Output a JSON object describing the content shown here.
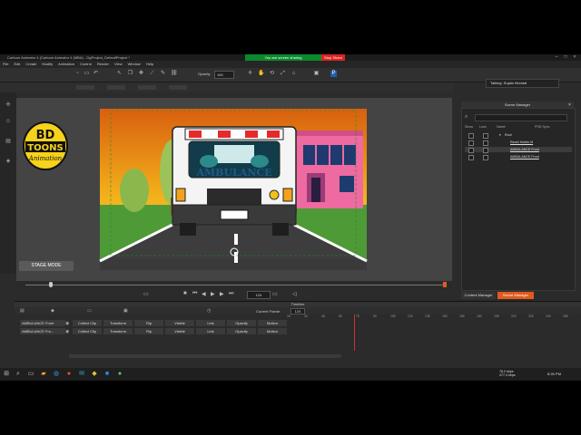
{
  "window": {
    "title": "Cartoon Animator 4 (Cartoon Animator 4 (MBA) - DgProject_DefaultProject *",
    "share_notice": "You are screen sharing",
    "stop_share": "Stop Share"
  },
  "menu": [
    "File",
    "Edit",
    "Create",
    "Modify",
    "Animation",
    "Control",
    "Render",
    "View",
    "Window",
    "Help"
  ],
  "toolbar": {
    "opacity_label": "Opacity",
    "opacity_value": "100"
  },
  "talking": "Talking: Sujato Mondal",
  "stage": {
    "mode_label": "STAGE MODE"
  },
  "playback": {
    "frame": "124"
  },
  "scene_manager": {
    "title": "Scene Manager",
    "columns": {
      "show": "Show",
      "lock": "Lock",
      "name": "Name",
      "psd": "PSD Sync"
    },
    "items": [
      {
        "name": "Root",
        "expanded": true
      },
      {
        "name": "Ricshi Holeto M"
      },
      {
        "name": "AMBULANCE Front"
      },
      {
        "name": "AMBULANCE Front"
      }
    ]
  },
  "panel_tabs": {
    "content_manager": "Content Manager",
    "scene_manager": "Scene Manager"
  },
  "timeline": {
    "title": "Timeline",
    "current_frame_label": "Current Frame:",
    "current_frame": "124",
    "ruler": [
      "15",
      "30",
      "45",
      "60",
      "75",
      "90",
      "105",
      "120",
      "135",
      "150",
      "165",
      "180",
      "195",
      "210",
      "225",
      "240",
      "255"
    ],
    "tracks": [
      {
        "name": "AMBULANCE Front",
        "cells": [
          "Collect Clip",
          "Transform",
          "Flip",
          "Visible",
          "Link",
          "Opacity",
          "Motion"
        ]
      },
      {
        "name": "AMBULANCE Fro...",
        "cells": [
          "Collect Clip",
          "Transform",
          "Flip",
          "Visible",
          "Link",
          "Opacity",
          "Motion"
        ]
      }
    ]
  },
  "taskbar": {
    "net_up": "78.0 kbps",
    "net_down": "477.4 kbps",
    "time": "8:26 PM"
  },
  "logo": {
    "line1": "BD",
    "line2": "TOONS",
    "line3": "Animation"
  },
  "scene_art": {
    "vehicle_label": "AMBULANCE"
  },
  "colors": {
    "accent": "#e05a1e",
    "share_green": "#0a8a2a",
    "stop_red": "#dd2222"
  }
}
